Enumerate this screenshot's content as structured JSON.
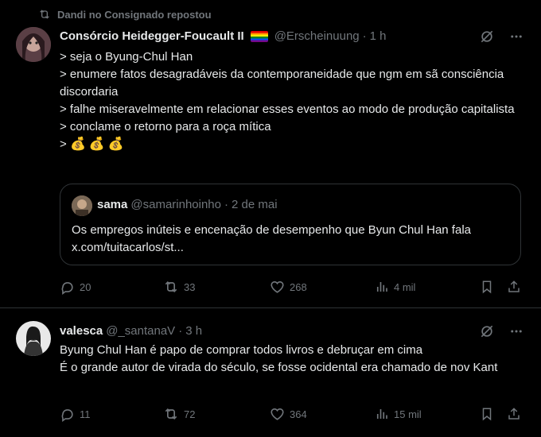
{
  "post1": {
    "repost_by": "Dandi no Consignado repostou",
    "author_name": "Consórcio Heidegger-Foucault II",
    "handle": "@Erscheinuung",
    "dot": "·",
    "time": "1 h",
    "lines": [
      "> seja o Byung-Chul Han",
      "> enumere fatos desagradáveis da contemporaneidade que ngm em sã consciência discordaria",
      "> falhe miseravelmente em relacionar esses eventos ao modo de produção capitalista",
      "> conclame o retorno para a roça mítica"
    ],
    "last_line_prefix": ">",
    "emoji": "💰",
    "quote": {
      "name": "sama",
      "handle": "@samarinhoinho",
      "dot": "·",
      "date": "2 de mai",
      "text": "Os empregos inúteis e encenação de desempenho que Byun Chul Han fala x.com/tuitacarlos/st..."
    },
    "stats": {
      "replies": "20",
      "reposts": "33",
      "likes": "268",
      "views": "4 mil"
    }
  },
  "post2": {
    "author_name": "valesca",
    "handle": "@_santanaV",
    "dot": "·",
    "time": "3 h",
    "text": "Byung Chul Han é papo de comprar todos livros e debruçar em cima\nÉ o grande autor de virada do século, se fosse ocidental era chamado de nov Kant",
    "stats": {
      "replies": "11",
      "reposts": "72",
      "likes": "364",
      "views": "15 mil"
    }
  },
  "icons": [
    "repost-icon",
    "grok-icon",
    "more-icon",
    "reply-icon",
    "like-icon",
    "views-icon",
    "bookmark-icon",
    "share-icon"
  ],
  "colors": {
    "background": "#000000",
    "text": "#e7e9ea",
    "muted": "#71767b",
    "border": "#2f3336"
  }
}
